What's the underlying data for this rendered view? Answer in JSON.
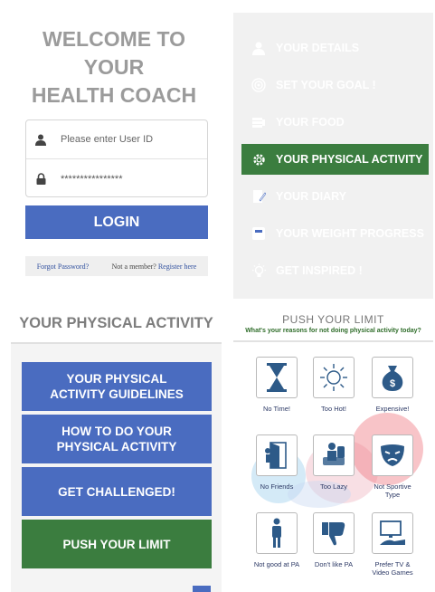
{
  "login": {
    "welcome_lines": [
      "WELCOME TO",
      "YOUR",
      "HEALTH COACH"
    ],
    "user_placeholder": "Please enter User ID",
    "password_value": "****************",
    "login_label": "LOGIN",
    "forgot_label": "Forgot Password?",
    "not_member_label": "Not a member?",
    "register_label": "Register here"
  },
  "menu": {
    "items": [
      {
        "label": "YOUR DETAILS",
        "icon": "person-icon",
        "color": "#4a6cc0"
      },
      {
        "label": "SET YOUR GOAL !",
        "icon": "target-icon",
        "color": "#4a6cc0"
      },
      {
        "label": "YOUR FOOD",
        "icon": "food-icon",
        "color": "#4a6cc0"
      },
      {
        "label": "YOUR PHYSICAL ACTIVITY",
        "icon": "gear-icon",
        "color": "#3b7d3f"
      },
      {
        "label": "YOUR DIARY",
        "icon": "diary-icon",
        "color": "#4a6cc0"
      },
      {
        "label": "YOUR WEIGHT PROGRESS",
        "icon": "scale-icon",
        "color": "#4a6cc0"
      },
      {
        "label": "GET INSPIRED !",
        "icon": "lightbulb-icon",
        "color": "#4a6cc0"
      }
    ]
  },
  "activity": {
    "title": "YOUR PHYSICAL ACTIVITY",
    "buttons": [
      {
        "label": "YOUR PHYSICAL\nACTIVITY GUIDELINES",
        "color": "#4a6cc0"
      },
      {
        "label": "HOW TO DO YOUR\nPHYSICAL ACTIVITY",
        "color": "#4a6cc0"
      },
      {
        "label": "GET CHALLENGED!",
        "color": "#4a6cc0"
      },
      {
        "label": "PUSH YOUR LIMIT",
        "color": "#3b7d3f"
      }
    ]
  },
  "push_limit": {
    "title": "PUSH YOUR LIMIT",
    "subtitle": "What's your reasons for not doing physical activity today?",
    "reasons": [
      {
        "label": "No Time!",
        "icon": "hourglass-icon"
      },
      {
        "label": "Too Hot!",
        "icon": "sun-icon"
      },
      {
        "label": "Expensive!",
        "icon": "money-bag-icon"
      },
      {
        "label": "No Friends",
        "icon": "door-icon"
      },
      {
        "label": "Too Lazy",
        "icon": "couch-icon"
      },
      {
        "label": "Not Sportive\nType",
        "icon": "mask-icon"
      },
      {
        "label": "Not good at PA",
        "icon": "standing-person-icon"
      },
      {
        "label": "Don't like PA",
        "icon": "thumbs-down-icon"
      },
      {
        "label": "Prefer TV &\nVideo Games",
        "icon": "tv-icon"
      }
    ]
  },
  "colors": {
    "primary": "#4a6cc0",
    "accent_green": "#3b7d3f",
    "heading_grey": "#9b9b9b"
  }
}
